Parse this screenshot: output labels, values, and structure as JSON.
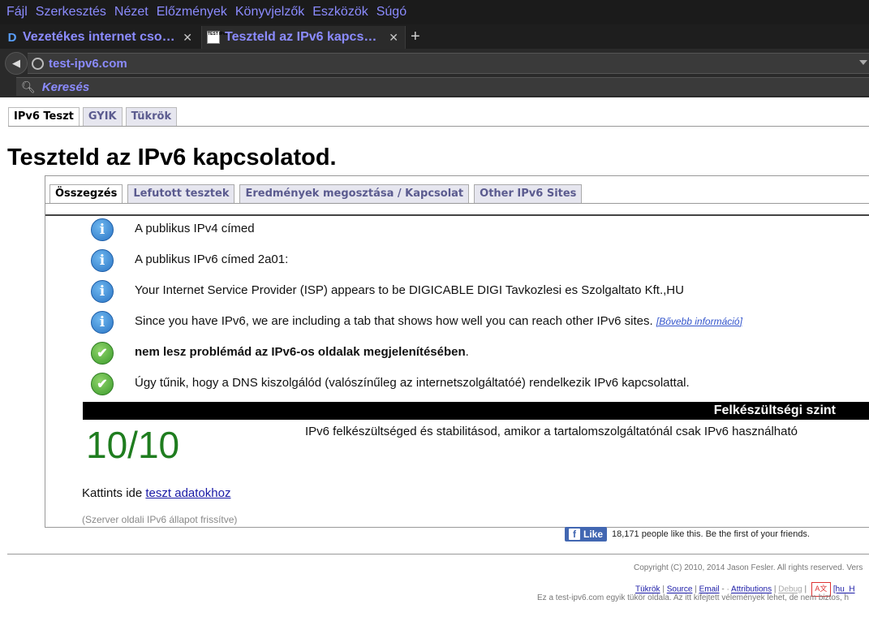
{
  "browser": {
    "menu": [
      "Fájl",
      "Szerkesztés",
      "Nézet",
      "Előzmények",
      "Könyvjelzők",
      "Eszközök",
      "Súgó"
    ],
    "tabs": [
      {
        "title": "Vezetékes internet cso…",
        "favicon": "d-logo-icon"
      },
      {
        "title": "Teszteld az IPv6 kapcso…",
        "favicon": "test-ipv6-favicon-icon"
      }
    ],
    "url": "test-ipv6.com",
    "search_placeholder": "Keresés"
  },
  "site": {
    "tabs": [
      "IPv6 Teszt",
      "GYIK",
      "Tükrök"
    ],
    "title": "Teszteld az IPv6 kapcsolatod.",
    "inner_tabs": [
      "Összegzés",
      "Lefutott tesztek",
      "Eredmények megosztása / Kapcsolat",
      "Other IPv6 Sites"
    ],
    "results": [
      {
        "icon": "info-icon",
        "text": "A publikus IPv4 címed"
      },
      {
        "icon": "info-icon",
        "text": "A publikus IPv6 címed 2a01:"
      },
      {
        "icon": "info-icon",
        "text": "Your Internet Service Provider (ISP) appears to be DIGICABLE DIGI Tavkozlesi es Szolgaltato Kft.,HU"
      },
      {
        "icon": "info-icon",
        "text": "Since you have IPv6, we are including a tab that shows how well you can reach other IPv6 sites.",
        "link": "[Bővebb információ]"
      },
      {
        "icon": "check-icon",
        "bold": "nem lesz problémád az IPv6-os oldalak megjelenítésében",
        "text": "."
      },
      {
        "icon": "check-icon",
        "text": "Úgy tűnik, hogy a DNS kiszolgálód (valószínűleg az internetszolgáltatóé) rendelkezik IPv6 kapcsolattal."
      }
    ],
    "readiness_label": "Felkészültségi szint",
    "score": "10/10",
    "score_desc": "IPv6 felkészültséged és stabilitásod, amikor a tartalomszolgáltatónál csak IPv6 használható",
    "test_link_prefix": "Kattints ide",
    "test_link": "teszt adatokhoz",
    "server_note": "(Szerver oldali IPv6 állapot frissítve)",
    "fb_like": "Like",
    "fb_text": "18,171 people like this. Be the first of your friends.",
    "copyright": "Copyright (C) 2010, 2014 Jason Fesler. All rights reserved. Vers",
    "footer_links": {
      "mirrors": "Tükrök",
      "source": "Source",
      "email": "Email",
      "sep": "-",
      "attributions": "Attributions",
      "debug": "Debug",
      "lang": "[hu_H"
    },
    "mirror_note": "Ez a test-ipv6.com egyik tükör oldala. Az itt kifejtett vélemények lehet, de nem biztos, h"
  }
}
